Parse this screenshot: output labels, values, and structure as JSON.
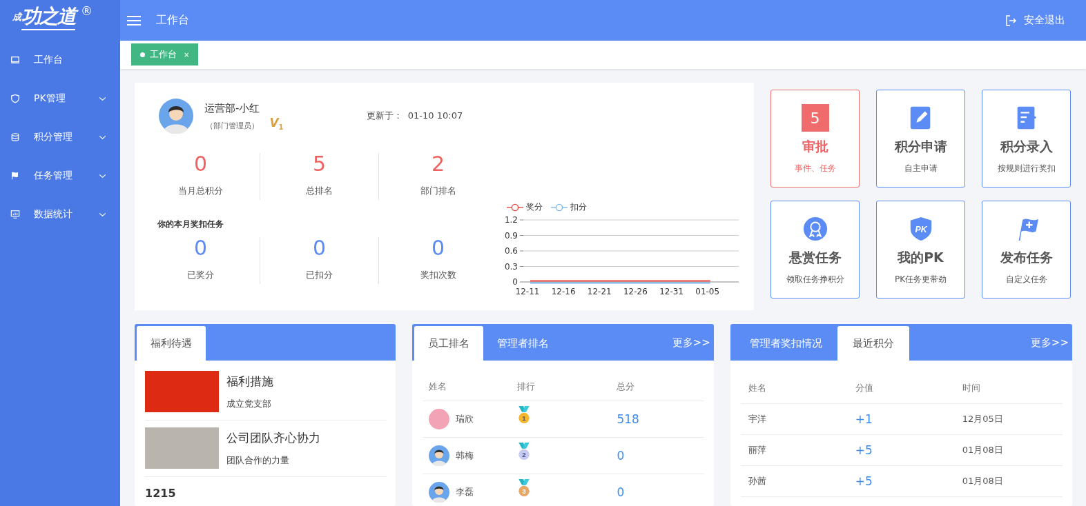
{
  "logo": {
    "prefix": "成",
    "name": "功之道",
    "mark": "®"
  },
  "sidebar": {
    "items": [
      {
        "label": "工作台",
        "expandable": false
      },
      {
        "label": "PK管理",
        "expandable": true
      },
      {
        "label": "积分管理",
        "expandable": true
      },
      {
        "label": "任务管理",
        "expandable": true
      },
      {
        "label": "数据统计",
        "expandable": true
      }
    ]
  },
  "header": {
    "title": "工作台",
    "logout": "安全退出"
  },
  "tabs": [
    {
      "label": "工作台",
      "selected": true,
      "close": "×"
    }
  ],
  "profile": {
    "name": "运营部-小红",
    "role": "（部门管理员）",
    "badge_letter": "V",
    "level": "1",
    "updated_label": "更新于：",
    "updated": "01-10 10:07"
  },
  "stats": [
    {
      "value": "0",
      "label": "当月总积分"
    },
    {
      "value": "5",
      "label": "总排名"
    },
    {
      "value": "2",
      "label": "部门排名"
    }
  ],
  "tasks_title": "你的本月奖扣任务",
  "task_stats": [
    {
      "value": "0",
      "label": "已奖分"
    },
    {
      "value": "0",
      "label": "已扣分"
    },
    {
      "value": "0",
      "label": "奖扣次数"
    }
  ],
  "chart_data": {
    "type": "line",
    "grid": true,
    "legend": true,
    "categories": [
      "12-11",
      "12-16",
      "12-21",
      "12-26",
      "12-31",
      "01-05"
    ],
    "ylim": [
      0,
      1.2
    ],
    "yticks": [
      0,
      0.3,
      0.6,
      0.9,
      1.2
    ],
    "series": [
      {
        "name": "奖分",
        "color": "#e8453c",
        "values": [
          0,
          0,
          0,
          0,
          0,
          0
        ]
      },
      {
        "name": "扣分",
        "color": "#7ab8f0",
        "values": [
          0,
          0,
          0,
          0,
          0,
          0
        ]
      }
    ]
  },
  "shortcuts": [
    {
      "kind": "alert",
      "badge": "5",
      "title": "审批",
      "subtitle": "事件、任务"
    },
    {
      "kind": "normal",
      "title": "积分申请",
      "subtitle": "自主申请"
    },
    {
      "kind": "normal",
      "title": "积分录入",
      "subtitle": "按规则进行奖扣"
    },
    {
      "kind": "normal",
      "title": "悬赏任务",
      "subtitle": "领取任务挣积分"
    },
    {
      "kind": "normal",
      "icon_label": "PK",
      "title": "我的PK",
      "subtitle": "PK任务更带劲"
    },
    {
      "kind": "normal",
      "title": "发布任务",
      "subtitle": "自定义任务"
    }
  ],
  "welfare": {
    "tabs": [
      {
        "label": "福利待遇",
        "selected": true
      }
    ],
    "items": [
      {
        "title": "福利措施",
        "subtitle": "成立党支部"
      },
      {
        "title": "公司团队齐心协力",
        "subtitle": "团队合作的力量"
      }
    ],
    "footer": "1215"
  },
  "rankings": {
    "tabs": [
      {
        "label": "员工排名",
        "selected": true
      },
      {
        "label": "管理者排名",
        "selected": false
      }
    ],
    "more": "更多>>",
    "columns": [
      "姓名",
      "排行",
      "总分"
    ],
    "rows": [
      {
        "name": "瑞欣",
        "rank": "1",
        "color": "#f2b72c",
        "total": "518"
      },
      {
        "name": "韩梅",
        "rank": "2",
        "color": "#c7cbf2",
        "total": "0"
      },
      {
        "name": "李磊",
        "rank": "3",
        "color": "#e9a765",
        "total": "0"
      }
    ]
  },
  "recent": {
    "tabs": [
      {
        "label": "管理者奖扣情况",
        "selected": false
      },
      {
        "label": "最近积分",
        "selected": true
      }
    ],
    "more": "更多>>",
    "columns": [
      "姓名",
      "分值",
      "时间"
    ],
    "rows": [
      {
        "name": "宇洋",
        "score": "+1",
        "time": "12月05日"
      },
      {
        "name": "丽萍",
        "score": "+5",
        "time": "01月08日"
      },
      {
        "name": "孙茜",
        "score": "+5",
        "time": "01月08日"
      }
    ]
  }
}
